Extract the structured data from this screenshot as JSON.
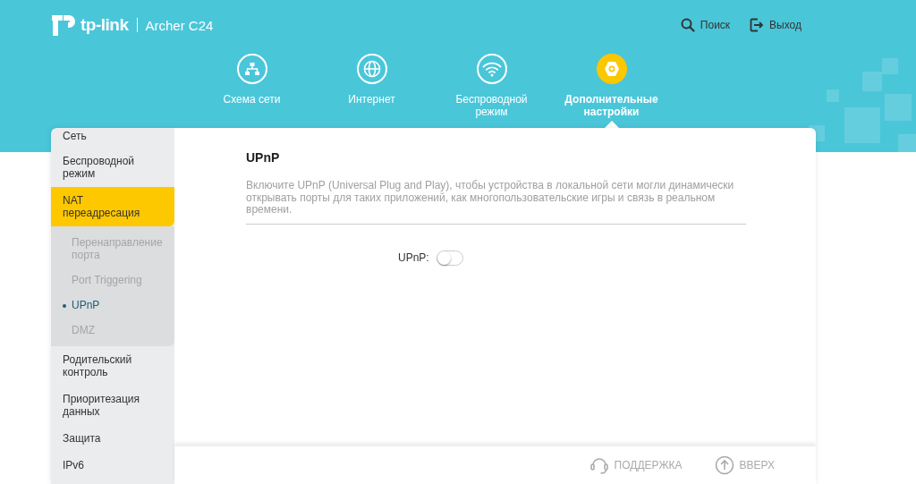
{
  "header": {
    "brand": "tp-link",
    "model": "Archer C24",
    "actions": [
      {
        "label": "Поиск",
        "kind": "search"
      },
      {
        "label": "Выход",
        "kind": "logout"
      }
    ]
  },
  "nav": [
    {
      "label": "Схема сети",
      "kind": "network",
      "selected": false
    },
    {
      "label": "Интернет",
      "kind": "globe",
      "selected": false
    },
    {
      "label": "Беспроводной режим",
      "kind": "wifi",
      "selected": false
    },
    {
      "label": "Дополнительные настройки",
      "kind": "gear",
      "selected": true
    }
  ],
  "sidebar": [
    {
      "label": "Сеть",
      "selected": false
    },
    {
      "label": "Беспроводной режим",
      "selected": false
    },
    {
      "label": "NAT переадресация",
      "selected": true,
      "children": [
        {
          "label": "Перенаправление порта",
          "selected": false
        },
        {
          "label": "Port Triggering",
          "selected": false
        },
        {
          "label": "UPnP",
          "selected": true
        },
        {
          "label": "DMZ",
          "selected": false
        }
      ]
    },
    {
      "label": "Родительский контроль",
      "selected": false
    },
    {
      "label": "Приоритезация данных",
      "selected": false
    },
    {
      "label": "Защита",
      "selected": false
    },
    {
      "label": "IPv6",
      "selected": false
    }
  ],
  "content": {
    "title": "UPnP",
    "description": "Включите UPnP (Universal Plug and Play), чтобы устройства в локальной сети могли динамически открывать порты для таких приложений, как многопользовательские игры и связь в реальном времени.",
    "fields": [
      {
        "label": "UPnP:",
        "kind": "toggle",
        "on": false
      }
    ]
  },
  "footer": [
    {
      "label": "ПОДДЕРЖКА",
      "kind": "support"
    },
    {
      "label": "ВВЕРХ",
      "kind": "top"
    }
  ]
}
